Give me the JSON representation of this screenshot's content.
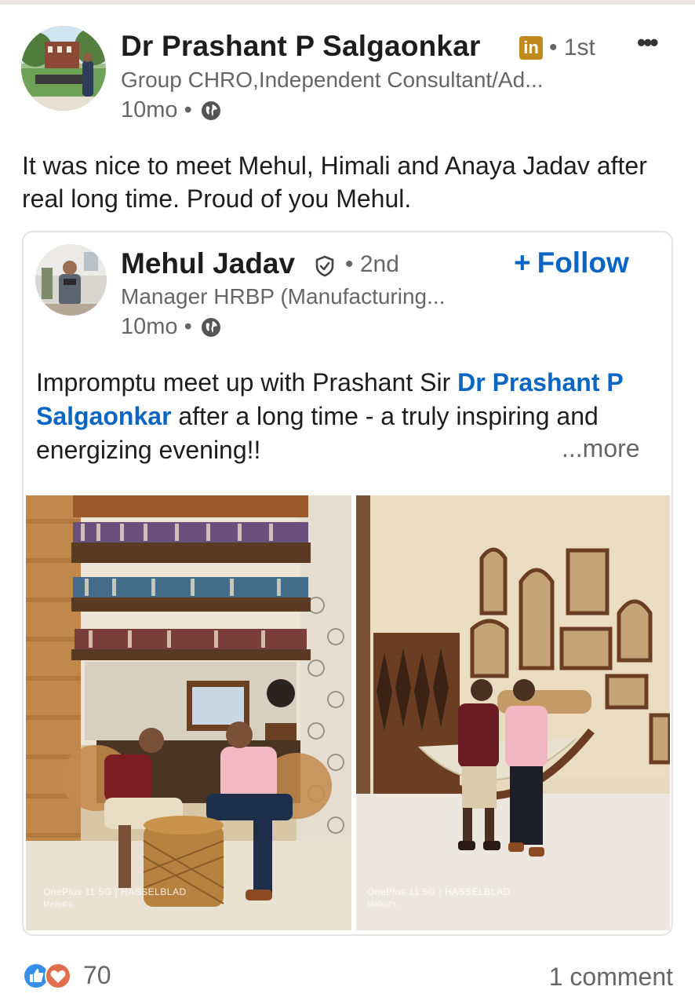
{
  "author": {
    "name": "Dr  Prashant P  Salgaonkar",
    "badge": "in",
    "degree": "• 1st",
    "headline": "Group CHRO,Independent Consultant/Ad...",
    "time": "10mo •"
  },
  "more_menu_icon": "more-horizontal-icon",
  "post_text": "It was nice to meet Mehul, Himali and Anaya Jadav after real long time. Proud of you Mehul.",
  "reshared": {
    "name": "Mehul Jadav",
    "degree": "• 2nd",
    "follow_label": "Follow",
    "headline": "Manager HRBP (Manufacturing...",
    "time": "10mo •",
    "text_before": "Impromptu meet up with Prashant Sir ",
    "mention": "Dr Prashant P  Salgaonkar",
    "text_after": " after a long time - a truly inspiring and energizing evening!!",
    "see_more": "...more",
    "photos": [
      {
        "watermark": "OnePlus 11 5G | HASSELBLAD",
        "sub": "Mehul's"
      },
      {
        "watermark": "OnePlus 11 5G | HASSELBLAD",
        "sub": "Mehul's"
      }
    ]
  },
  "footer": {
    "reaction_count": "70",
    "comments": "1 comment"
  },
  "colors": {
    "link": "#0a66c2",
    "like": "#378fe9",
    "love": "#df704d",
    "linkedin_badge": "#c08a1e"
  }
}
